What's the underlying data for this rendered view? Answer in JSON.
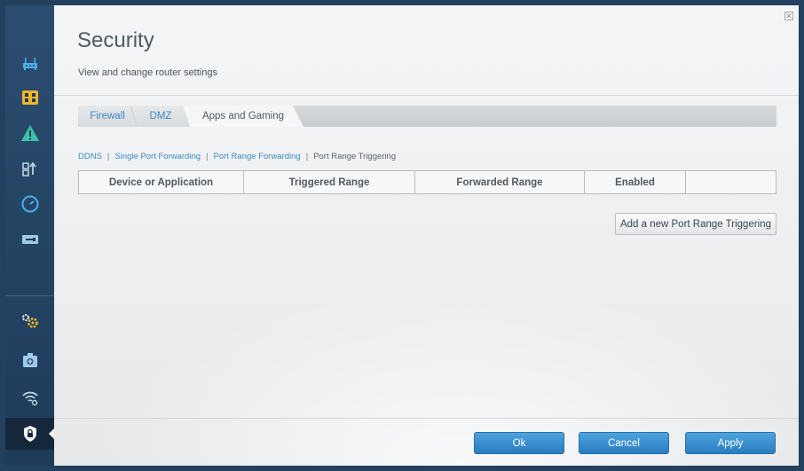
{
  "header": {
    "title": "Security",
    "subtitle": "View and change router settings",
    "close_glyph": "✕"
  },
  "sidebar": {
    "items": [
      {
        "icon": "router-icon"
      },
      {
        "icon": "device-list-icon"
      },
      {
        "icon": "warning-icon"
      },
      {
        "icon": "media-prioritization-icon"
      },
      {
        "icon": "speed-test-icon"
      },
      {
        "icon": "external-storage-icon"
      },
      {
        "icon": "connectivity-gear-icon"
      },
      {
        "icon": "troubleshooting-icon"
      },
      {
        "icon": "wireless-icon"
      },
      {
        "icon": "security-lock-icon",
        "active": true
      }
    ]
  },
  "tabs": [
    {
      "label": "Firewall"
    },
    {
      "label": "DMZ"
    },
    {
      "label": "Apps and Gaming",
      "active": true
    }
  ],
  "subnav": {
    "items": [
      {
        "label": "DDNS"
      },
      {
        "label": "Single Port Forwarding"
      },
      {
        "label": "Port Range Forwarding"
      },
      {
        "label": "Port Range Triggering",
        "current": true
      }
    ],
    "separator": "|"
  },
  "table": {
    "headers": [
      "Device or Application",
      "Triggered Range",
      "Forwarded Range",
      "Enabled",
      ""
    ]
  },
  "add_button": "Add a new Port Range Triggering",
  "footer": {
    "ok": "Ok",
    "cancel": "Cancel",
    "apply": "Apply"
  },
  "colors": {
    "accent": "#2a7cc0",
    "link": "#3d8ac6",
    "sidebar": "#23405e"
  }
}
